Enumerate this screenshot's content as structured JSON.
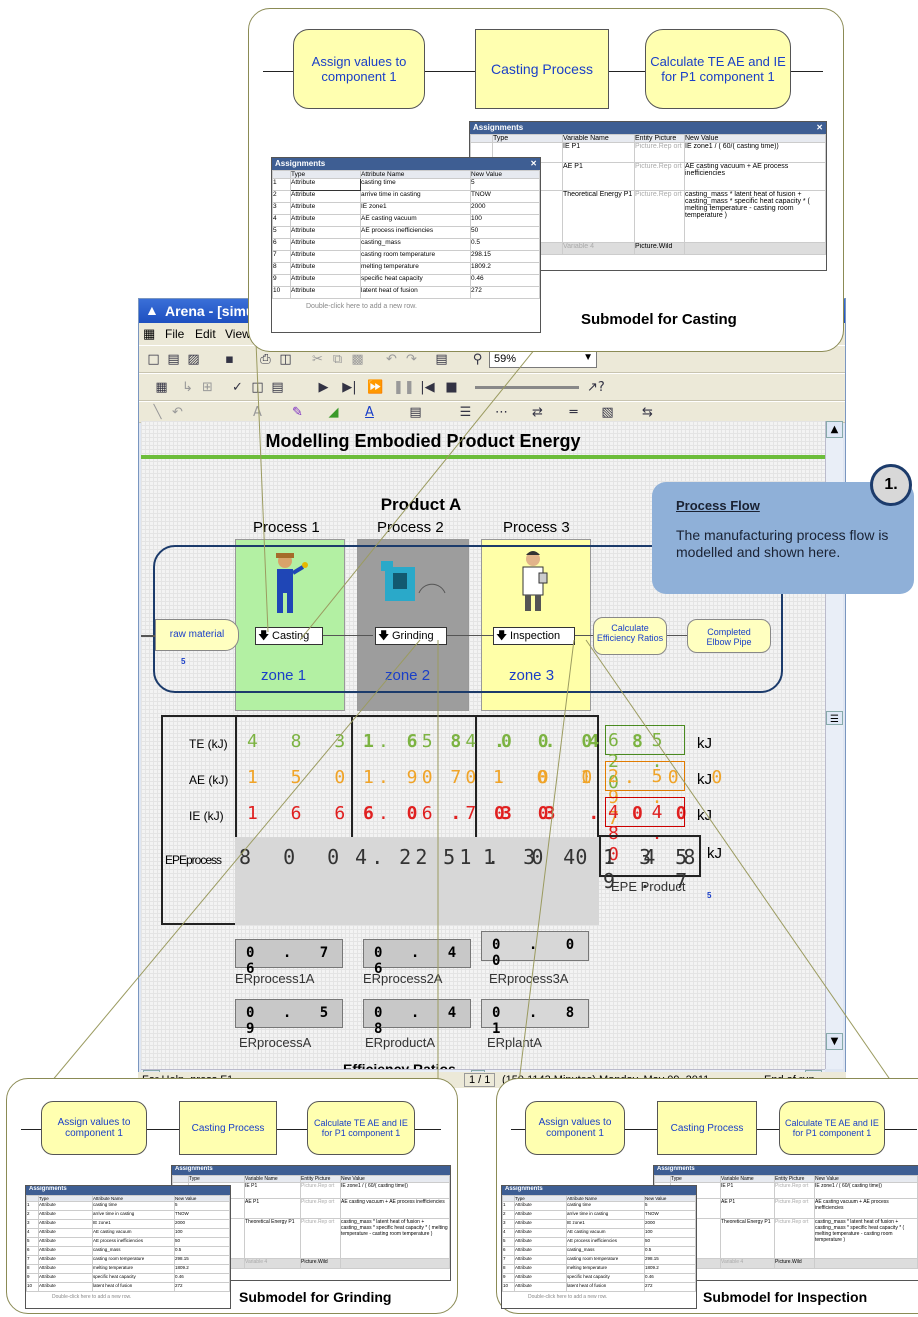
{
  "window": {
    "title": "Arena - [simul",
    "menu": [
      "File",
      "Edit",
      "View"
    ],
    "zoom": "59%"
  },
  "canvas": {
    "heading": "Modelling Embodied Product Energy",
    "product": "Product A",
    "processes": [
      "Process 1",
      "Process 2",
      "Process 3"
    ],
    "zones": [
      "zone 1",
      "zone 2",
      "zone 3"
    ],
    "modules": {
      "raw": "raw material",
      "raw_count": "5",
      "casting": "Casting",
      "grinding": "Grinding",
      "inspection": "Inspection",
      "calc": "Calculate Efficiency Ratios",
      "completed": "Completed Elbow Pipe"
    },
    "rows": [
      {
        "label": "TE (kJ)",
        "v1": "4 8 3 . 5 4",
        "v2": "1 6 8 . 0 0",
        "v3": "0 . 4 8",
        "total": "6 5 2 . 0",
        "unit": "kJ"
      },
      {
        "label": "AE (kJ)",
        "v1": "1 5 0 . 0 0",
        "v2": "1 9 7 . 0 0",
        "v3": "1 0 1 . 0 0",
        "total": "2 5 9 . 7",
        "unit": "kJ"
      },
      {
        "label": "IE (kJ)",
        "v1": "1 6 6 . 6 7",
        "v2": "6 0 . 0 0",
        "v3": "3 3 . 0 0",
        "total": "4 4 8 . 0",
        "unit": "kJ"
      },
      {
        "label": "EPEprocess",
        "v1": "8 0 0 . 2 1",
        "v2": "4 2 5 . 0 0",
        "v3": "1 3 4 . 4 8",
        "total": "1 3 5 9 . 7",
        "unit": "kJ"
      }
    ],
    "epe_product": "EPE Product",
    "epe_count": "5",
    "er_process": [
      {
        "value": "0 . 7 6",
        "label": "ERprocess1A"
      },
      {
        "value": "0 . 4 6",
        "label": "ERprocess2A"
      },
      {
        "value": "0 . 0 0",
        "label": "ERprocess3A"
      }
    ],
    "er_overall": [
      {
        "value": "0 . 5 9",
        "label": "ERprocessA"
      },
      {
        "value": "0 . 4 8",
        "label": "ERproductA"
      },
      {
        "value": "0 . 8 1",
        "label": "ERplantA"
      }
    ],
    "eff_title": "Efficiency Ratios"
  },
  "statusbar": {
    "help": "For Help, press F1",
    "page": "1 / 1",
    "time": "(159.1143 Minutes) Monday, May 09, 2011",
    "end": "End of run"
  },
  "callout": {
    "number": "1.",
    "title": "Process Flow",
    "text": "The manufacturing process flow is modelled and shown here."
  },
  "submodel": {
    "assign": "Assign values to component 1",
    "casting": "Casting Process",
    "calc": "Calculate TE  AE and IE for P1 component 1",
    "dlg_title": "Assignments",
    "attr_headers": [
      "",
      "Type",
      "Attribute Name",
      "New Value"
    ],
    "attr_rows": [
      [
        "1",
        "Attribute",
        "casting time",
        "5"
      ],
      [
        "2",
        "Attribute",
        "arrive time in casting",
        "TNOW"
      ],
      [
        "3",
        "Attribute",
        "IE zone1",
        "2000"
      ],
      [
        "4",
        "Attribute",
        "AE casting vacuum",
        "100"
      ],
      [
        "5",
        "Attribute",
        "AE process inefficiencies",
        "50"
      ],
      [
        "6",
        "Attribute",
        "casting_mass",
        "0.5"
      ],
      [
        "7",
        "Attribute",
        "casting room temperature",
        "298.15"
      ],
      [
        "8",
        "Attribute",
        "melting temperature",
        "1809.2"
      ],
      [
        "9",
        "Attribute",
        "specific heat capacity",
        "0.46"
      ],
      [
        "10",
        "Attribute",
        "latent heat of fusion",
        "272"
      ]
    ],
    "add_row": "Double-click here to add a new row.",
    "var_headers": [
      "Type",
      "Variable Name",
      "Entity Picture",
      "New Value"
    ],
    "var_rows": [
      [
        "",
        "IE P1",
        "Picture.Rep ort",
        "IE zone1 / ( 60/( casting time))"
      ],
      [
        "",
        "AE P1",
        "Picture.Rep ort",
        "AE casting vacuum + AE process inefficiencies"
      ],
      [
        "",
        "Theoretical Energy P1",
        "Picture.Rep ort",
        "casting_mass * latent heat of fusion + casting_mass * specific heat capacity  * ( melting temperature - casting room temperature )"
      ],
      [
        "re",
        "Variable 4",
        "Picture.Wild",
        ""
      ]
    ],
    "titles": [
      "Submodel for Casting",
      "Submodel for Grinding",
      "Submodel for Inspection"
    ]
  }
}
